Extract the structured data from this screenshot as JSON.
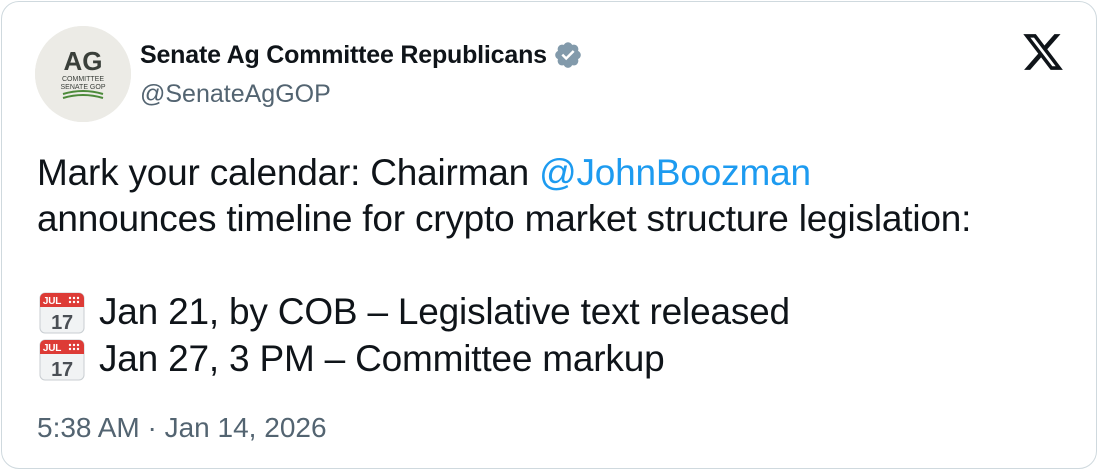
{
  "author": {
    "display_name": "Senate Ag Committee Republicans",
    "handle": "@SenateAgGOP",
    "verified": true,
    "avatar": {
      "logo_text": "AG",
      "line1": "COMMITTEE",
      "line2": "SENATE GOP"
    }
  },
  "platform_icon": "x-logo-icon",
  "tweet": {
    "line1_prefix": "Mark your calendar: Chairman ",
    "mention": "@JohnBoozman",
    "line2": "announces timeline for crypto market structure legislation:",
    "events": [
      {
        "icon": "calendar-icon",
        "calendar_month": "JUL",
        "calendar_day": "17",
        "text": "Jan 21, by COB – Legislative text released"
      },
      {
        "icon": "calendar-icon",
        "calendar_month": "JUL",
        "calendar_day": "17",
        "text": "Jan 27, 3 PM – Committee markup"
      }
    ]
  },
  "timestamp": "5:38 AM · Jan 14, 2026",
  "colors": {
    "text": "#0f1419",
    "secondary": "#536471",
    "link": "#1d9bf0",
    "border": "#cfd9de",
    "verified_badge": "#829aab"
  }
}
